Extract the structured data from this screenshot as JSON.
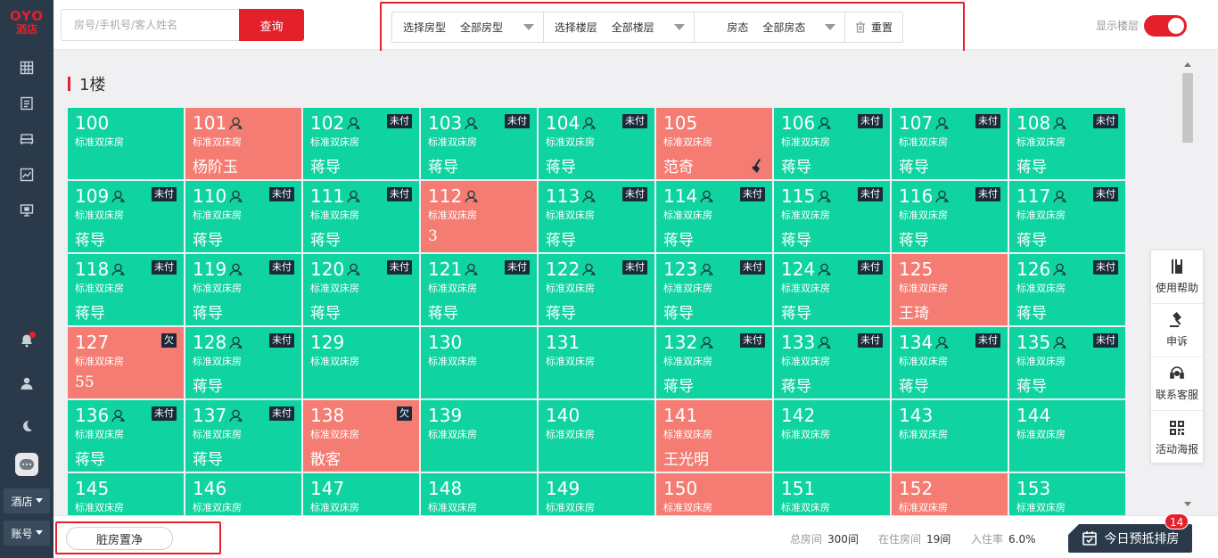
{
  "brand": {
    "logo_text": "OYO",
    "logo_sub": "酒店"
  },
  "sidebar": {
    "icons": [
      "grid-icon",
      "list-icon",
      "bed-icon",
      "chart-icon",
      "monitor-icon",
      "bell-icon",
      "user-icon",
      "moon-icon"
    ],
    "hotel_dropdown": "酒店",
    "account_dropdown": "账号"
  },
  "search": {
    "placeholder": "房号/手机号/客人姓名",
    "value": "",
    "button": "查询"
  },
  "filters": [
    {
      "label": "选择房型",
      "value": "全部房型"
    },
    {
      "label": "选择楼层",
      "value": "全部楼层"
    },
    {
      "label": "房态",
      "value": "全部房态"
    }
  ],
  "reset_label": "重置",
  "show_floor": {
    "label": "显示楼层",
    "on": true
  },
  "floor": {
    "name": "1楼"
  },
  "rooms": [
    {
      "no": "100",
      "type": "标准双床房",
      "guest": "",
      "status": "vacant"
    },
    {
      "no": "101",
      "type": "标准双床房",
      "guest": "杨阶玉",
      "status": "occupied",
      "ico": true
    },
    {
      "no": "102",
      "type": "标准双床房",
      "guest": "蒋导",
      "status": "vacant",
      "ico": true,
      "tag": "未付"
    },
    {
      "no": "103",
      "type": "标准双床房",
      "guest": "蒋导",
      "status": "vacant",
      "ico": true,
      "tag": "未付"
    },
    {
      "no": "104",
      "type": "标准双床房",
      "guest": "蒋导",
      "status": "vacant",
      "ico": true,
      "tag": "未付"
    },
    {
      "no": "105",
      "type": "标准双床房",
      "guest": "范奇",
      "status": "occupied",
      "clean": true
    },
    {
      "no": "106",
      "type": "标准双床房",
      "guest": "蒋导",
      "status": "vacant",
      "ico": true,
      "tag": "未付"
    },
    {
      "no": "107",
      "type": "标准双床房",
      "guest": "蒋导",
      "status": "vacant",
      "ico": true,
      "tag": "未付"
    },
    {
      "no": "108",
      "type": "标准双床房",
      "guest": "蒋导",
      "status": "vacant",
      "ico": true,
      "tag": "未付"
    },
    {
      "no": "109",
      "type": "标准双床房",
      "guest": "蒋导",
      "status": "vacant",
      "ico": true,
      "tag": "未付"
    },
    {
      "no": "110",
      "type": "标准双床房",
      "guest": "蒋导",
      "status": "vacant",
      "ico": true,
      "tag": "未付"
    },
    {
      "no": "111",
      "type": "标准双床房",
      "guest": "蒋导",
      "status": "vacant",
      "ico": true,
      "tag": "未付"
    },
    {
      "no": "112",
      "type": "标准双床房",
      "guest": "3",
      "status": "occupied",
      "ico": true
    },
    {
      "no": "113",
      "type": "标准双床房",
      "guest": "蒋导",
      "status": "vacant",
      "ico": true,
      "tag": "未付"
    },
    {
      "no": "114",
      "type": "标准双床房",
      "guest": "蒋导",
      "status": "vacant",
      "ico": true,
      "tag": "未付"
    },
    {
      "no": "115",
      "type": "标准双床房",
      "guest": "蒋导",
      "status": "vacant",
      "ico": true,
      "tag": "未付"
    },
    {
      "no": "116",
      "type": "标准双床房",
      "guest": "蒋导",
      "status": "vacant",
      "ico": true,
      "tag": "未付"
    },
    {
      "no": "117",
      "type": "标准双床房",
      "guest": "蒋导",
      "status": "vacant",
      "ico": true,
      "tag": "未付"
    },
    {
      "no": "118",
      "type": "标准双床房",
      "guest": "蒋导",
      "status": "vacant",
      "ico": true,
      "tag": "未付"
    },
    {
      "no": "119",
      "type": "标准双床房",
      "guest": "蒋导",
      "status": "vacant",
      "ico": true,
      "tag": "未付"
    },
    {
      "no": "120",
      "type": "标准双床房",
      "guest": "蒋导",
      "status": "vacant",
      "ico": true,
      "tag": "未付"
    },
    {
      "no": "121",
      "type": "标准双床房",
      "guest": "蒋导",
      "status": "vacant",
      "ico": true,
      "tag": "未付"
    },
    {
      "no": "122",
      "type": "标准双床房",
      "guest": "蒋导",
      "status": "vacant",
      "ico": true,
      "tag": "未付"
    },
    {
      "no": "123",
      "type": "标准双床房",
      "guest": "蒋导",
      "status": "vacant",
      "ico": true,
      "tag": "未付"
    },
    {
      "no": "124",
      "type": "标准双床房",
      "guest": "蒋导",
      "status": "vacant",
      "ico": true,
      "tag": "未付"
    },
    {
      "no": "125",
      "type": "标准双床房",
      "guest": "王琦",
      "status": "occupied"
    },
    {
      "no": "126",
      "type": "标准双床房",
      "guest": "蒋导",
      "status": "vacant",
      "ico": true,
      "tag": "未付"
    },
    {
      "no": "127",
      "type": "标准双床房",
      "guest": "55",
      "status": "occupied",
      "tag": "欠"
    },
    {
      "no": "128",
      "type": "标准双床房",
      "guest": "蒋导",
      "status": "vacant",
      "ico": true,
      "tag": "未付"
    },
    {
      "no": "129",
      "type": "标准双床房",
      "guest": "",
      "status": "vacant"
    },
    {
      "no": "130",
      "type": "标准双床房",
      "guest": "",
      "status": "vacant"
    },
    {
      "no": "131",
      "type": "标准双床房",
      "guest": "",
      "status": "vacant"
    },
    {
      "no": "132",
      "type": "标准双床房",
      "guest": "蒋导",
      "status": "vacant",
      "ico": true,
      "tag": "未付"
    },
    {
      "no": "133",
      "type": "标准双床房",
      "guest": "蒋导",
      "status": "vacant",
      "ico": true,
      "tag": "未付"
    },
    {
      "no": "134",
      "type": "标准双床房",
      "guest": "蒋导",
      "status": "vacant",
      "ico": true,
      "tag": "未付"
    },
    {
      "no": "135",
      "type": "标准双床房",
      "guest": "蒋导",
      "status": "vacant",
      "ico": true,
      "tag": "未付"
    },
    {
      "no": "136",
      "type": "标准双床房",
      "guest": "蒋导",
      "status": "vacant",
      "ico": true,
      "tag": "未付"
    },
    {
      "no": "137",
      "type": "标准双床房",
      "guest": "蒋导",
      "status": "vacant",
      "ico": true,
      "tag": "未付"
    },
    {
      "no": "138",
      "type": "标准双床房",
      "guest": "散客",
      "status": "occupied",
      "tag": "欠"
    },
    {
      "no": "139",
      "type": "标准双床房",
      "guest": "",
      "status": "vacant"
    },
    {
      "no": "140",
      "type": "标准双床房",
      "guest": "",
      "status": "vacant"
    },
    {
      "no": "141",
      "type": "标准双床房",
      "guest": "王光明",
      "status": "occupied"
    },
    {
      "no": "142",
      "type": "标准双床房",
      "guest": "",
      "status": "vacant"
    },
    {
      "no": "143",
      "type": "标准双床房",
      "guest": "",
      "status": "vacant"
    },
    {
      "no": "144",
      "type": "标准双床房",
      "guest": "",
      "status": "vacant"
    },
    {
      "no": "145",
      "type": "标准双床房",
      "guest": "",
      "status": "vacant"
    },
    {
      "no": "146",
      "type": "标准双床房",
      "guest": "",
      "status": "vacant"
    },
    {
      "no": "147",
      "type": "标准双床房",
      "guest": "",
      "status": "vacant"
    },
    {
      "no": "148",
      "type": "标准双床房",
      "guest": "",
      "status": "vacant"
    },
    {
      "no": "149",
      "type": "标准双床房",
      "guest": "",
      "status": "vacant"
    },
    {
      "no": "150",
      "type": "标准双床房",
      "guest": "",
      "status": "occupied"
    },
    {
      "no": "151",
      "type": "标准双床房",
      "guest": "",
      "status": "vacant"
    },
    {
      "no": "152",
      "type": "标准双床房",
      "guest": "",
      "status": "occupied"
    },
    {
      "no": "153",
      "type": "标准双床房",
      "guest": "",
      "status": "vacant"
    }
  ],
  "help_panel": [
    {
      "label": "使用帮助",
      "icon": "book-icon"
    },
    {
      "label": "申诉",
      "icon": "gavel-icon"
    },
    {
      "label": "联系客服",
      "icon": "headset-icon"
    },
    {
      "label": "活动海报",
      "icon": "qrcode-icon"
    }
  ],
  "bottom": {
    "dirty_clean_btn": "脏房置净",
    "total_rooms_label": "总房间",
    "total_rooms_value": "300间",
    "occupied_label": "在住房间",
    "occupied_value": "19间",
    "occupancy_label": "入住率",
    "occupancy_value": "6.0%",
    "prebook_btn": "今日预抵排房",
    "prebook_badge": "14"
  },
  "colors": {
    "accent": "#e4202a",
    "vacant": "#0fd3a0",
    "occupied": "#f57c72",
    "sidebar": "#2b3a4a"
  }
}
